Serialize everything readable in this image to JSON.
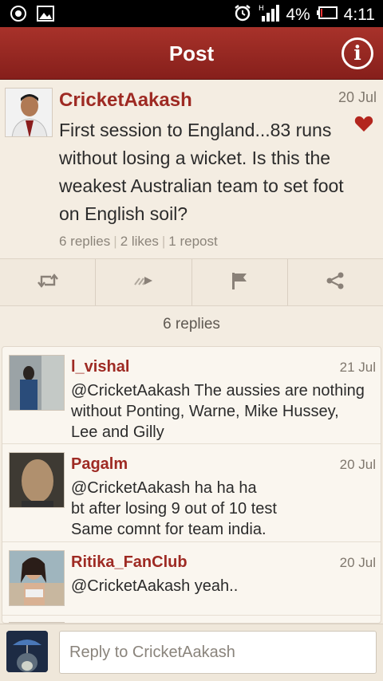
{
  "status_bar": {
    "battery": "4%",
    "time": "4:11"
  },
  "header": {
    "title": "Post",
    "info_label": "i"
  },
  "post": {
    "author": "CricketAakash",
    "date": "20 Jul",
    "text": "First session to England...83 runs without losing a wicket. Is this the weakest Australian team to set foot on English soil?",
    "replies": "6 replies",
    "likes": "2 likes",
    "reposts": "1 repost",
    "liked": true
  },
  "actions": [
    "retweet-icon",
    "forward-icon",
    "flag-icon",
    "share-icon"
  ],
  "replies_header": "6 replies",
  "replies": [
    {
      "author": "l_vishal",
      "date": "21 Jul",
      "text": "@CricketAakash   The aussies are nothing without Ponting, Warne, Mike Hussey, Lee and Gilly"
    },
    {
      "author": "Pagalm",
      "date": "20 Jul",
      "text": "@CricketAakash ha ha ha\nbt after losing 9 out of 10 test\nSame comnt for team india."
    },
    {
      "author": "Ritika_FanClub",
      "date": "20 Jul",
      "text": "@CricketAakash yeah.."
    }
  ],
  "compose": {
    "placeholder": "Reply to CricketAakash"
  },
  "colors": {
    "accent": "#9e2a23",
    "header": "#96261f",
    "background": "#f3ece1"
  }
}
